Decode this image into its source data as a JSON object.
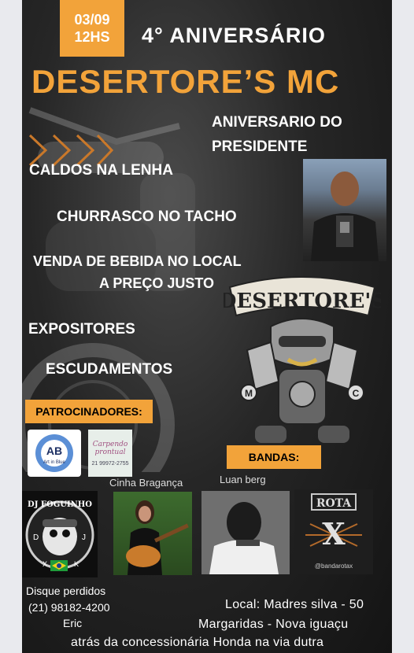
{
  "event": {
    "date": "03/09",
    "time": "12HS",
    "anniversary": "4° ANIVERSÁRIO",
    "club_name": "DESERTORE’S MC"
  },
  "highlights": {
    "president_line1": "ANIVERSARIO DO",
    "president_line2": "PRESIDENTE",
    "item1": "CALDOS  NA LENHA",
    "item2": "CHURRASCO NO TACHO",
    "item3_line1": "VENDA DE BEBIDA NO LOCAL",
    "item3_line2": "A PREÇO JUSTO",
    "item4": "EXPOSITORES",
    "item5": "ESCUDAMENTOS"
  },
  "logo": {
    "banner_text": "DESERTORE'S",
    "left_letter": "M",
    "right_letter": "C"
  },
  "sponsors": {
    "label": "PATROCINADORES:",
    "sponsor1_mark": "AB",
    "sponsor1_text": "Art in Blue",
    "sponsor2_text": "Carpendo prontual",
    "sponsor2_phone": "21 99972-2755"
  },
  "bands": {
    "label": "BANDAS:",
    "band1_logo_text": "DJ FOGUINHO",
    "band1_letters": [
      "D",
      "J",
      "X",
      "K"
    ],
    "band2_name": "Cinha Bragança",
    "band3_name": "Luan berg",
    "band4_logo_text": "ROTA",
    "band4_center": "X",
    "band4_handle": "@bandarotax"
  },
  "contact": {
    "line1": "Disque perdidos",
    "line2": "(21) 98182-4200",
    "line3": "Eric"
  },
  "location": {
    "line1": "Local: Madres silva - 50",
    "line2": "Margaridas  - Nova iguaçu",
    "line3": "atrás da concessionária Honda na via dutra"
  },
  "colors": {
    "accent": "#f2a33a",
    "text": "#ffffff"
  }
}
